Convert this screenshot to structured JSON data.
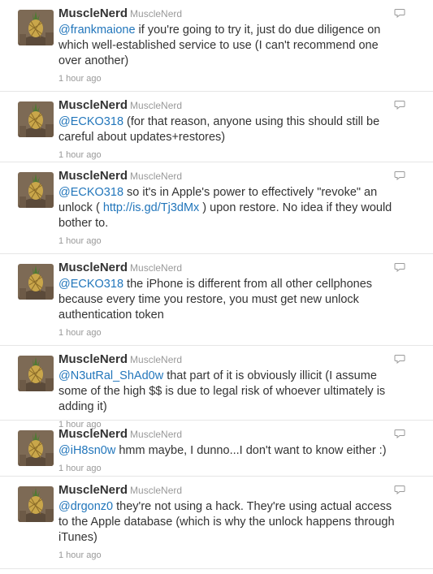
{
  "tweets": [
    {
      "user": "MuscleNerd",
      "handle": "MuscleNerd",
      "segments": [
        {
          "text": "@frankmaione",
          "link": true
        },
        {
          "text": " if you're going to try it, just do due diligence on which well-established service to use (I can't recommend one over another)"
        }
      ],
      "time": "1 hour ago"
    },
    {
      "user": "MuscleNerd",
      "handle": "MuscleNerd",
      "segments": [
        {
          "text": "@ECKO318",
          "link": true
        },
        {
          "text": " (for that reason, anyone using this should still be careful about updates+restores)"
        }
      ],
      "time": "1 hour ago"
    },
    {
      "user": "MuscleNerd",
      "handle": "MuscleNerd",
      "segments": [
        {
          "text": "@ECKO318",
          "link": true
        },
        {
          "text": " so it's in Apple's power to effectively \"revoke\" an unlock ( "
        },
        {
          "text": "http://is.gd/Tj3dMx",
          "link": true
        },
        {
          "text": " ) upon restore. No idea if they would bother to."
        }
      ],
      "time": "1 hour ago"
    },
    {
      "user": "MuscleNerd",
      "handle": "MuscleNerd",
      "segments": [
        {
          "text": "@ECKO318",
          "link": true
        },
        {
          "text": " the iPhone is different from all other cellphones because every time you restore, you must get new unlock authentication token"
        }
      ],
      "time": "1 hour ago"
    },
    {
      "user": "MuscleNerd",
      "handle": "MuscleNerd",
      "segments": [
        {
          "text": "@N3utRal_ShAd0w",
          "link": true
        },
        {
          "text": " that part of it is obviously illicit (I assume some of the high $$ is due to legal risk of whoever ultimately is adding it)"
        }
      ],
      "time": "1 hour ago"
    },
    {
      "user": "MuscleNerd",
      "handle": "MuscleNerd",
      "segments": [
        {
          "text": "@iH8sn0w",
          "link": true
        },
        {
          "text": " hmm maybe, I dunno...I don't want to know either :)"
        }
      ],
      "time": "1 hour ago"
    },
    {
      "user": "MuscleNerd",
      "handle": "MuscleNerd",
      "segments": [
        {
          "text": "@drgonz0",
          "link": true
        },
        {
          "text": " they're not using a hack. They're using actual access to the Apple database (which is why the unlock happens through iTunes)"
        }
      ],
      "time": "1 hour ago"
    }
  ],
  "icons": {
    "reply": "reply-speech-bubble-icon",
    "avatar": "pineapple-avatar"
  },
  "colors": {
    "link": "#2276bb",
    "meta": "#999999",
    "text": "#333333",
    "divider": "#e6e6e6"
  }
}
